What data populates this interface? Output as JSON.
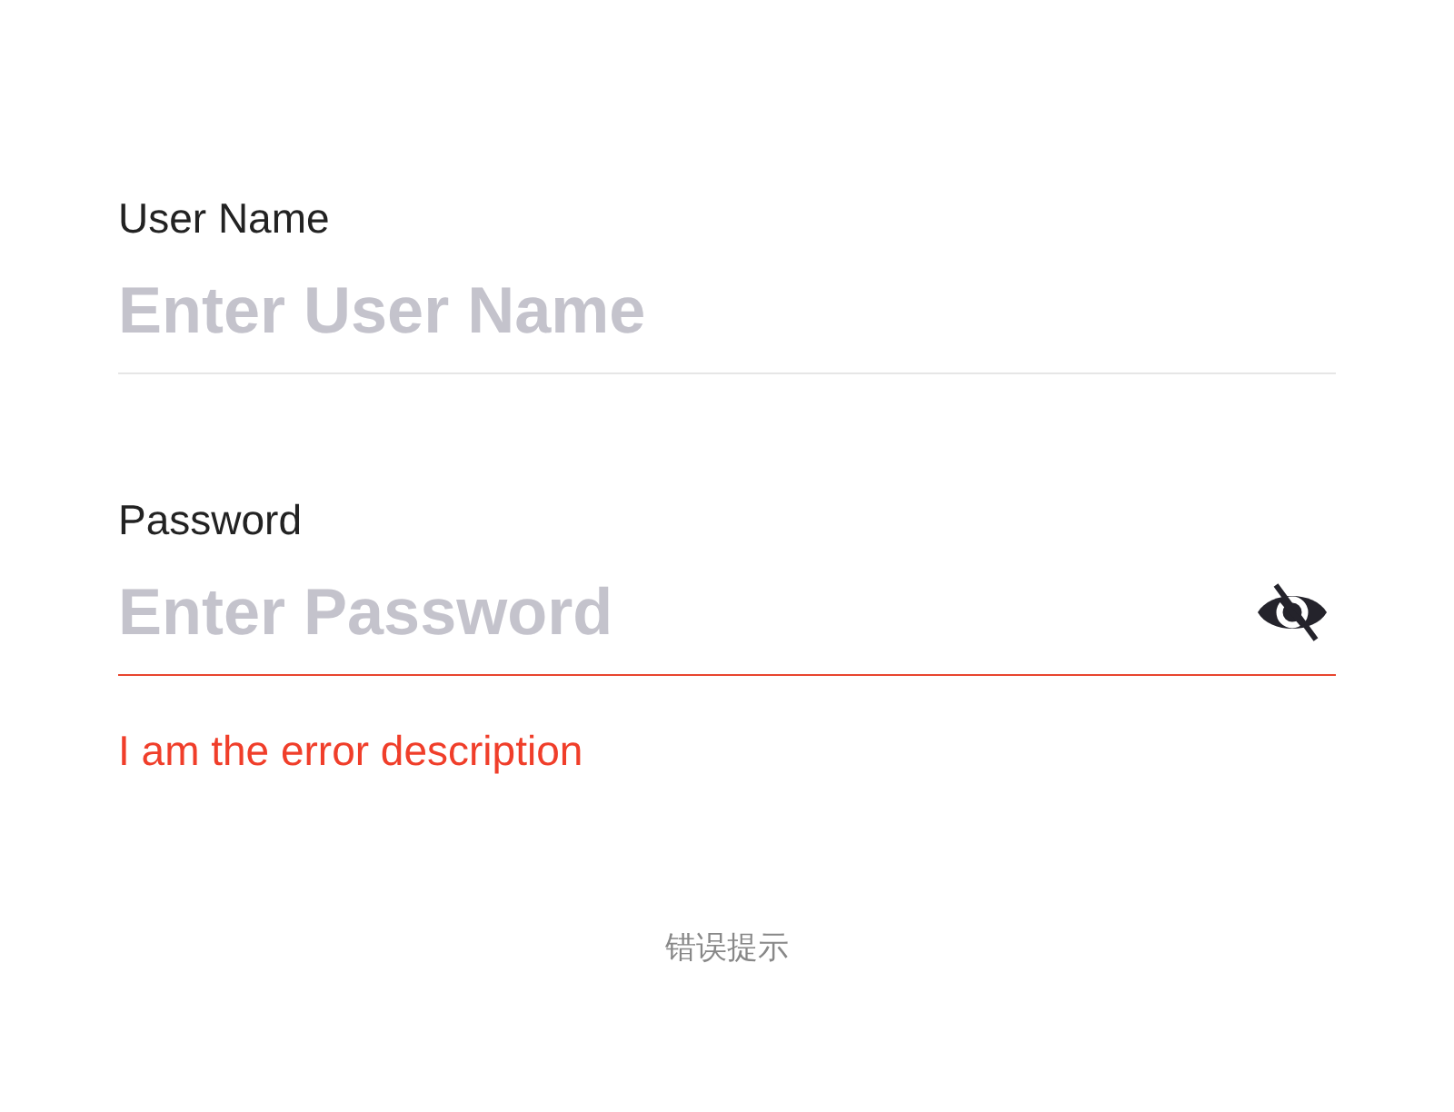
{
  "fields": [
    {
      "label": "User Name",
      "placeholder": "Enter User Name",
      "kind": "text",
      "error": false
    },
    {
      "label": "Password",
      "placeholder": "Enter Password",
      "kind": "password",
      "error": true,
      "error_text": "I am the error description"
    }
  ],
  "caption": "错误提示"
}
